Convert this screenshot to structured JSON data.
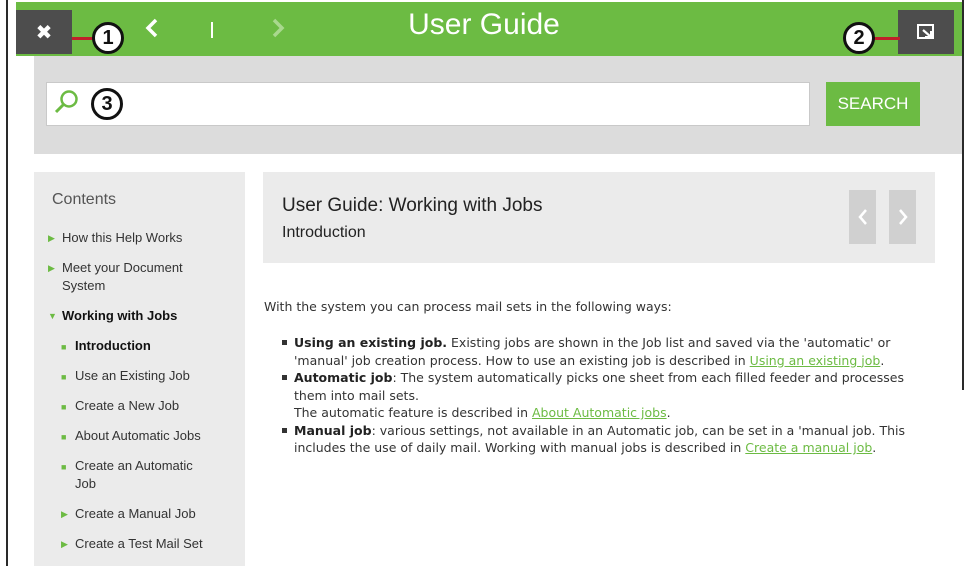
{
  "window": {
    "title": "User Guide",
    "close_glyph": "✖",
    "back_glyph": "‹",
    "forward_glyph": "›"
  },
  "callouts": {
    "one": "1",
    "two": "2",
    "three": "3"
  },
  "search": {
    "value": "",
    "button_label": "SEARCH"
  },
  "sidebar": {
    "title": "Contents",
    "items": [
      {
        "label": "How this Help Works"
      },
      {
        "label": "Meet your Document System"
      },
      {
        "label": "Working with Jobs"
      },
      {
        "label": "Introduction"
      },
      {
        "label": "Use an Existing Job"
      },
      {
        "label": "Create a New Job"
      },
      {
        "label": "About Automatic Jobs"
      },
      {
        "label": "Create an Automatic Job"
      },
      {
        "label": "Create a Manual Job"
      },
      {
        "label": "Create a Test Mail Set"
      }
    ]
  },
  "page": {
    "title": "User Guide: Working with Jobs",
    "subtitle": "Introduction",
    "intro": "With the system you can process mail sets in the following ways:",
    "bullets": [
      {
        "lead": "Using an existing job.",
        "text": " Existing jobs are shown in the Job list and saved via the 'automatic' or 'manual' job creation process. How to use an existing job is described in ",
        "link": "Using an existing job",
        "tail": "."
      },
      {
        "lead": "Automatic job",
        "text": ": The system automatically picks one sheet from each filled feeder and processes them into mail sets.",
        "text2": "The automatic feature is described in ",
        "link": "About Automatic jobs",
        "tail": "."
      },
      {
        "lead": "Manual job",
        "text": ": various settings, not available in an Automatic job, can be set in a 'manual job. This includes the use of daily mail. Working with manual jobs is described in ",
        "link": "Create a manual job",
        "tail": "."
      }
    ]
  },
  "colors": {
    "brand_green": "#6cbb43",
    "dark_button": "#4d4d4d",
    "panel_gray": "#ebebeb",
    "callout_line": "#c0202a"
  },
  "icons": {
    "close": "close-icon",
    "back": "chevron-left-icon",
    "forward": "chevron-right-icon",
    "popout": "popout-icon",
    "search": "search-icon"
  }
}
